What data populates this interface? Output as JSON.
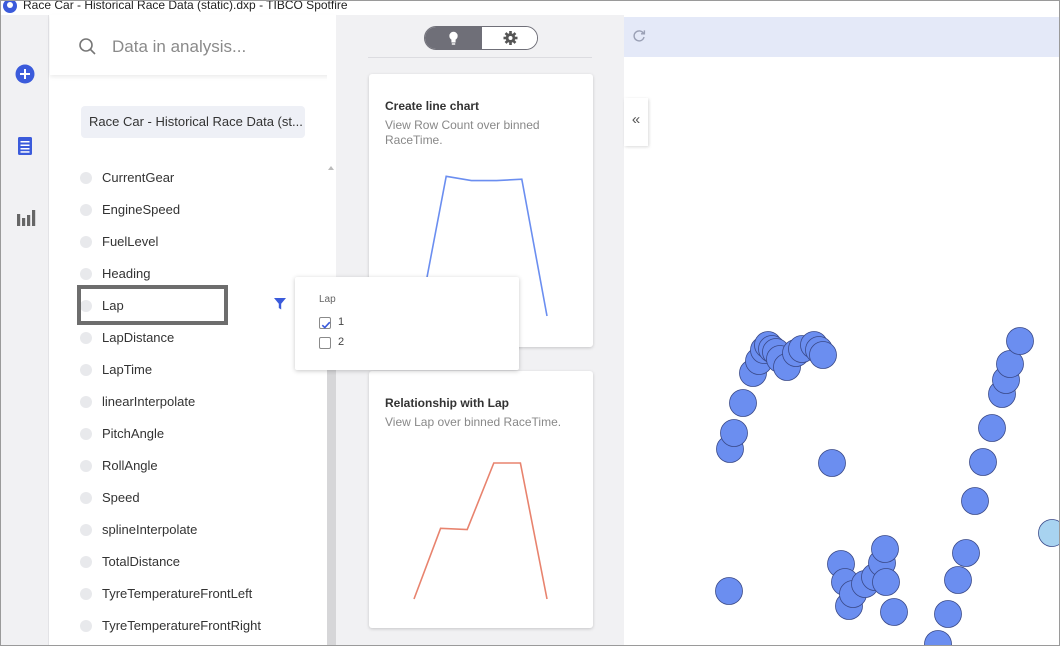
{
  "app": {
    "title": "Race Car - Historical Race Data (static).dxp - TIBCO Spotfire"
  },
  "left_rail": {
    "items": [
      {
        "icon": "add-circle-icon"
      },
      {
        "icon": "data-table-icon"
      },
      {
        "icon": "bar-chart-icon"
      }
    ]
  },
  "data_panel": {
    "search_placeholder": "Data in analysis...",
    "source_label": "Race Car - Historical Race Data (st...",
    "columns": [
      "CurrentGear",
      "EngineSpeed",
      "FuelLevel",
      "Heading",
      "Lap",
      "LapDistance",
      "LapTime",
      "linearInterpolate",
      "PitchAngle",
      "RollAngle",
      "Speed",
      "splineInterpolate",
      "TotalDistance",
      "TyreTemperatureFrontLeft",
      "TyreTemperatureFrontRight"
    ],
    "selected_column": "Lap"
  },
  "filter_popup": {
    "title": "Lap",
    "options": [
      {
        "label": "1",
        "checked": true
      },
      {
        "label": "2",
        "checked": false
      }
    ]
  },
  "recommendations": {
    "cards": [
      {
        "title": "Create line chart",
        "description": "View Row Count over binned RaceTime.",
        "line_color": "#6b8ef0",
        "values": [
          0.05,
          0.97,
          0.94,
          0.94,
          0.95,
          0.0
        ]
      },
      {
        "title": "Relationship with Lap",
        "description": "View Lap over binned RaceTime.",
        "line_color": "#e8836e",
        "values": [
          0.0,
          0.52,
          0.51,
          1.0,
          1.0,
          0.0
        ]
      }
    ]
  },
  "colors": {
    "accent": "#3b5bdb",
    "marker": "#6b8ef0",
    "marker_light": "#a8d3f0",
    "toolbar": "#e4e9f8"
  }
}
